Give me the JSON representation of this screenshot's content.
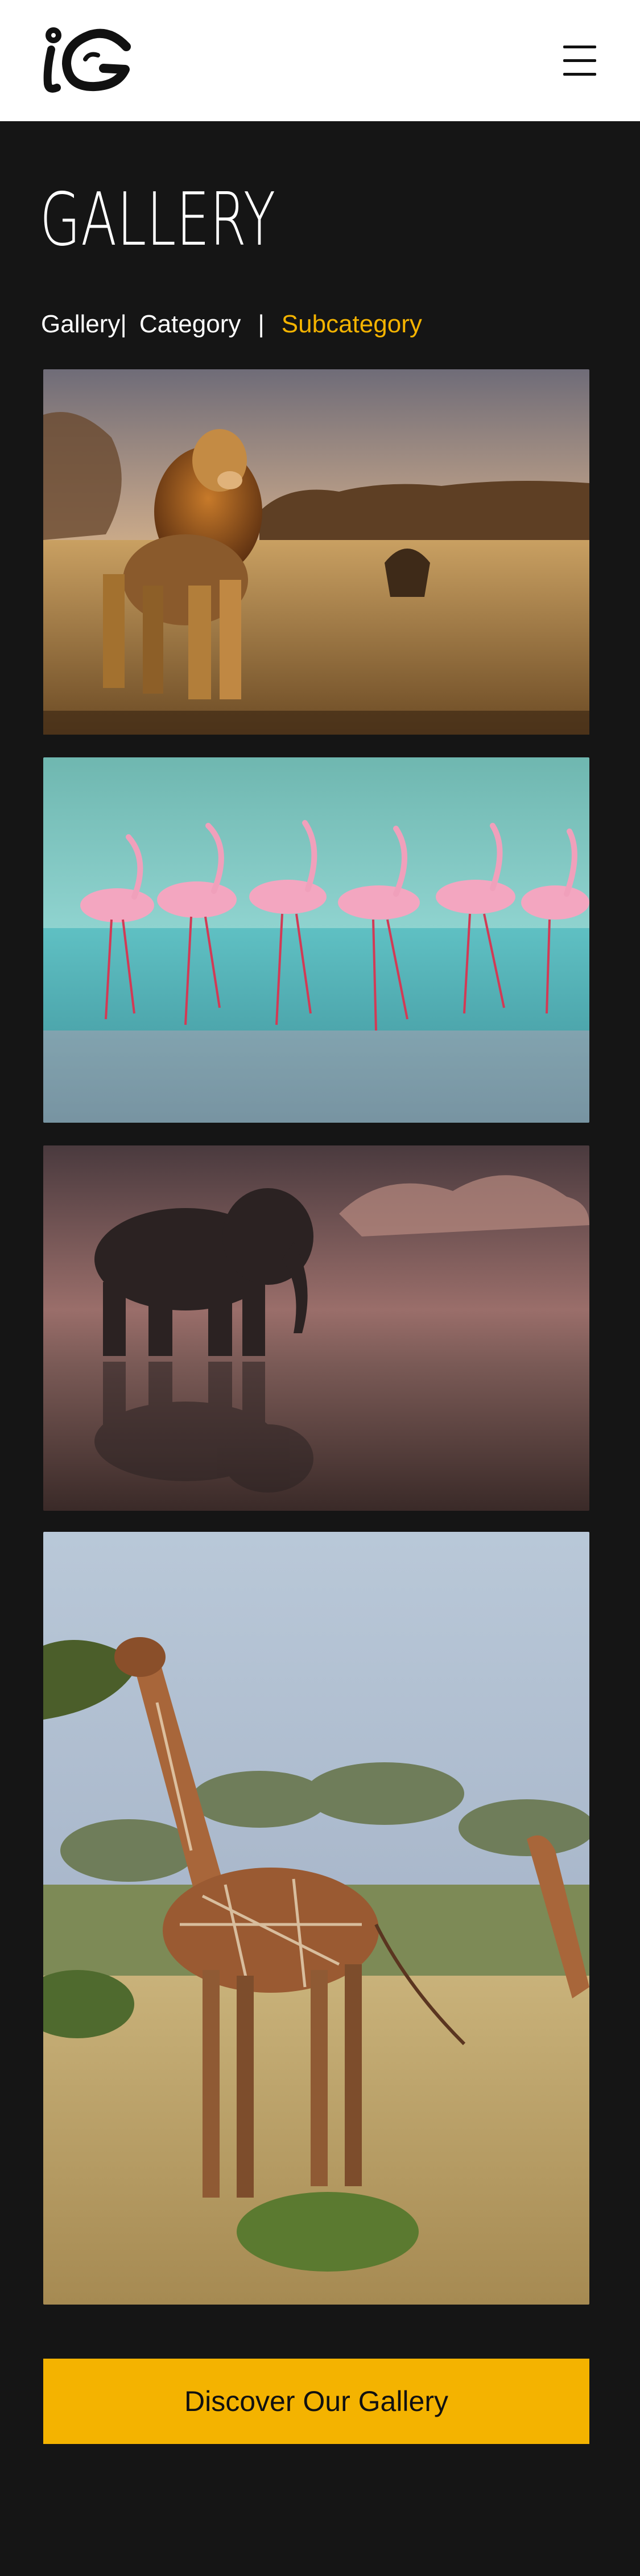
{
  "header": {
    "logo_text": "iG",
    "menu_icon": "hamburger-menu-icon"
  },
  "gallery": {
    "title": "GALLERY",
    "breadcrumb": {
      "items": [
        "Gallery",
        "Category",
        "Subcategory"
      ],
      "separator": "|"
    },
    "photos": [
      {
        "subject": "lion"
      },
      {
        "subject": "flamingos"
      },
      {
        "subject": "elephant"
      },
      {
        "subject": "giraffe"
      }
    ],
    "cta_label": "Discover Our Gallery"
  },
  "colors": {
    "header_bg": "#ffffff",
    "page_bg": "#151515",
    "accent": "#f4b300",
    "text": "#ffffff"
  }
}
